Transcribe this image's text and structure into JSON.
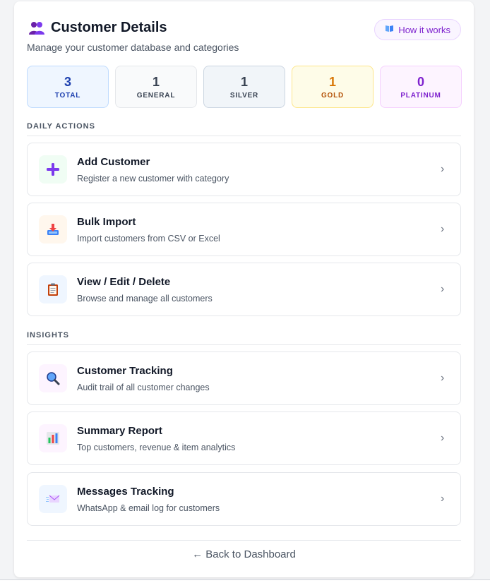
{
  "header": {
    "title": "Customer Details",
    "title_icon": "people-icon",
    "subtitle": "Manage your customer database and categories",
    "how_it_works": "How it works",
    "how_icon": "book-icon"
  },
  "stats": [
    {
      "value": "3",
      "label": "TOTAL",
      "color": "#1e40af",
      "bg": "#eff6ff",
      "border": "#bfdbfe"
    },
    {
      "value": "1",
      "label": "GENERAL",
      "color": "#374151",
      "bg": "#f9fafb",
      "border": "#e5e7eb"
    },
    {
      "value": "1",
      "label": "SILVER",
      "color": "#374151",
      "bg": "#f1f5f9",
      "border": "#cbd5e1"
    },
    {
      "value": "1",
      "label": "GOLD",
      "color": "#b45309",
      "bg": "#fefce8",
      "border": "#fde68a"
    },
    {
      "value": "0",
      "label": "PLATINUM",
      "color": "#7e22ce",
      "bg": "#fdf4ff",
      "border": "#f5d0fe"
    }
  ],
  "sections": {
    "daily": "DAILY ACTIONS",
    "insights": "INSIGHTS"
  },
  "daily_actions": [
    {
      "name": "Add Customer",
      "desc": "Register a new customer with category",
      "icon": "plus-icon"
    },
    {
      "name": "Bulk Import",
      "desc": "Import customers from CSV or Excel",
      "icon": "inbox-tray-icon"
    },
    {
      "name": "View / Edit / Delete",
      "desc": "Browse and manage all customers",
      "icon": "clipboard-icon"
    }
  ],
  "insights": [
    {
      "name": "Customer Tracking",
      "desc": "Audit trail of all customer changes",
      "icon": "magnifier-icon"
    },
    {
      "name": "Summary Report",
      "desc": "Top customers, revenue & item analytics",
      "icon": "bar-chart-icon"
    },
    {
      "name": "Messages Tracking",
      "desc": "WhatsApp & email log for customers",
      "icon": "envelope-icon"
    }
  ],
  "chevron": "›",
  "back_link": "← Back to Dashboard"
}
